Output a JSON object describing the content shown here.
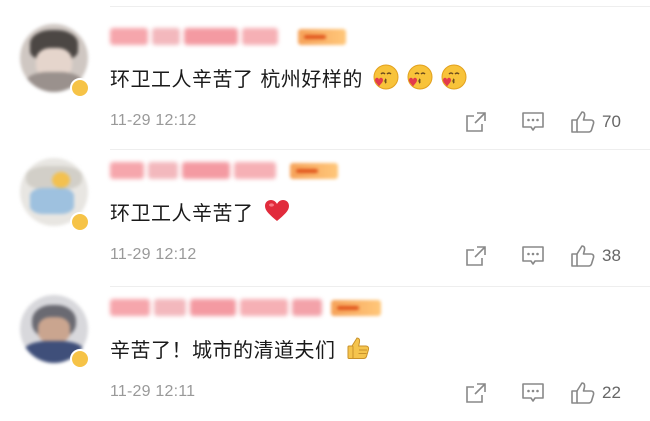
{
  "comments": [
    {
      "text": "环卫工人辛苦了 杭州好样的",
      "timestamp": "11-29 12:12",
      "like_count": "70",
      "emoji": [
        "kiss-heart-emoji",
        "kiss-heart-emoji",
        "kiss-heart-emoji"
      ]
    },
    {
      "text": "环卫工人辛苦了",
      "timestamp": "11-29 12:12",
      "like_count": "38",
      "emoji": [
        "red-heart-emoji"
      ]
    },
    {
      "text": "辛苦了！城市的清道夫们",
      "timestamp": "11-29 12:11",
      "like_count": "22",
      "emoji": [
        "thumbs-up-emoji"
      ]
    }
  ],
  "actions": {
    "share_icon": "share-icon",
    "comment_icon": "comment-icon",
    "like_icon": "thumbs-up-icon"
  },
  "colors": {
    "text": "#1a1a1a",
    "meta": "#999999",
    "icon": "#888888",
    "divider": "#eeeeee",
    "username_blur": "#f7a7ad",
    "badge": "#f6a35a"
  }
}
